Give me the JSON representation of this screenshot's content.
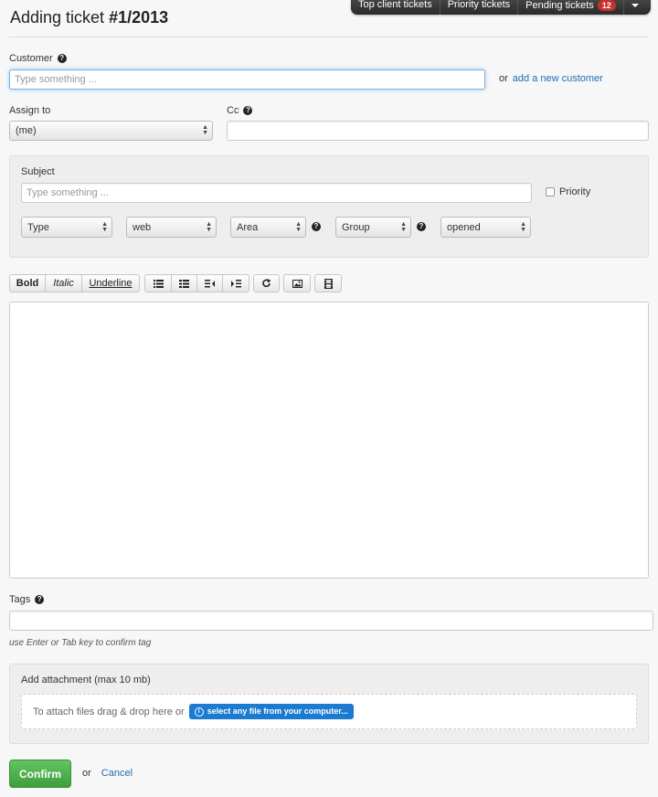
{
  "topnav": {
    "items": [
      {
        "label": "Top client tickets"
      },
      {
        "label": "Priority tickets"
      },
      {
        "label": "Pending tickets",
        "badge": "12"
      }
    ]
  },
  "page": {
    "title_prefix": "Adding ticket ",
    "title_number": "#1/2013"
  },
  "customer": {
    "label": "Customer",
    "placeholder": "Type something ...",
    "or_text": "or",
    "add_link": "add a new customer"
  },
  "assign_to": {
    "label": "Assign to",
    "value": "(me)"
  },
  "cc": {
    "label": "Cc",
    "value": ""
  },
  "subject": {
    "label": "Subject",
    "placeholder": "Type something ...",
    "priority_label": "Priority"
  },
  "selects": {
    "type": "Type",
    "source": "web",
    "area": "Area",
    "group": "Group",
    "status": "opened"
  },
  "toolbar": {
    "bold": "Bold",
    "italic": "Italic",
    "underline": "Underline"
  },
  "icons": [
    "help-icon",
    "unordered-list-icon",
    "ordered-list-icon",
    "outdent-icon",
    "indent-icon",
    "redo-icon",
    "image-icon",
    "video-icon",
    "info-icon",
    "dropdown-caret-icon"
  ],
  "tags": {
    "label": "Tags",
    "hint": "use Enter or Tab key to confirm tag"
  },
  "attachment": {
    "label": "Add attachment (max 10 mb)",
    "drop_text": "To attach files drag & drop here or",
    "select_button": "select any file from your computer..."
  },
  "footer": {
    "confirm": "Confirm",
    "or_text": "or",
    "cancel": "Cancel"
  },
  "colors": {
    "link": "#1f6fb5",
    "confirm_green": "#4cae4c",
    "badge_red": "#c9302c",
    "file_button_blue": "#1a7bd0"
  }
}
